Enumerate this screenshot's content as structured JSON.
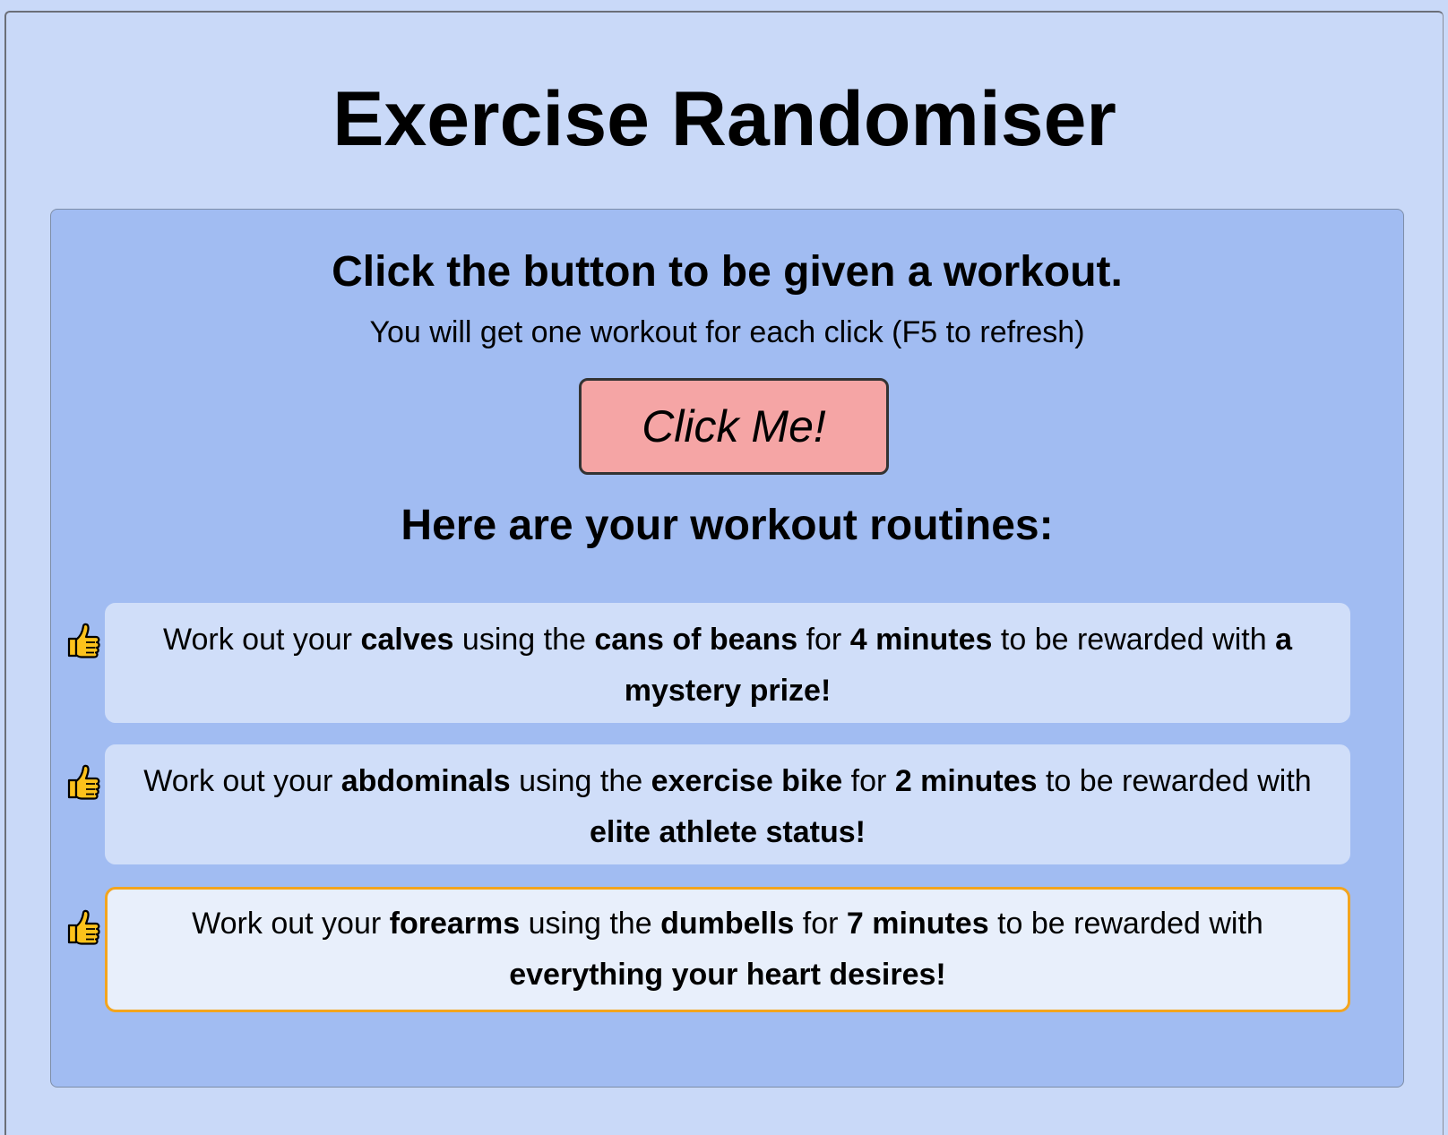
{
  "page": {
    "title": "Exercise Randomiser"
  },
  "panel": {
    "heading": "Click the button to be given a workout.",
    "subtitle": "You will get one workout for each click (F5 to refresh)",
    "button_label": "Click Me!",
    "routines_heading": "Here are your workout routines:"
  },
  "routines": [
    {
      "prefix": "Work out your",
      "muscle": "calves",
      "mid1": "using the",
      "equipment": "cans of beans",
      "mid2": "for",
      "duration": "4 minutes",
      "mid3": "to be rewarded with",
      "reward": "a mystery prize!",
      "highlighted": false
    },
    {
      "prefix": "Work out your",
      "muscle": "abdominals",
      "mid1": "using the",
      "equipment": "exercise bike",
      "mid2": "for",
      "duration": "2 minutes",
      "mid3": "to be rewarded with",
      "reward": "elite athlete status!",
      "highlighted": false
    },
    {
      "prefix": "Work out your",
      "muscle": "forearms",
      "mid1": "using the",
      "equipment": "dumbells",
      "mid2": "for",
      "duration": "7 minutes",
      "mid3": "to be rewarded with",
      "reward": "everything your heart desires!",
      "highlighted": true
    }
  ],
  "icons": {
    "routine_icon": "thumbs-up-icon"
  },
  "colors": {
    "page_background": "#c9d9f8",
    "panel_background": "#a1bcf2",
    "card_background": "#d0def9",
    "highlight_border": "#f3a51e",
    "button_background": "#f5a5a5",
    "thumb_fill": "#fcc21b"
  }
}
